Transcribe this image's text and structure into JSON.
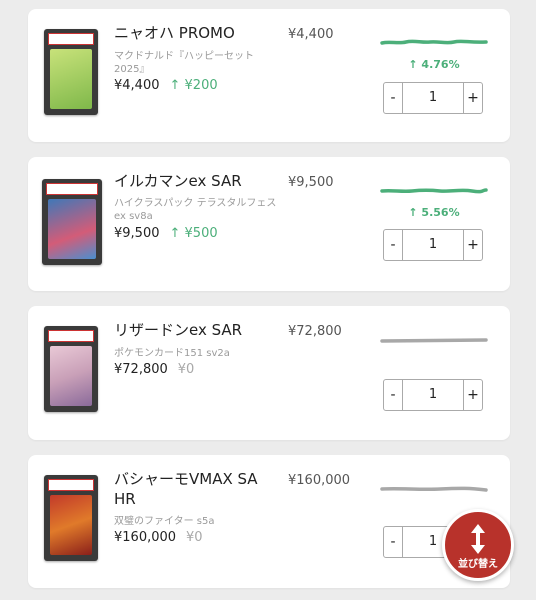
{
  "items": [
    {
      "name": "ニャオハ PROMO",
      "subtitle": "マクドナルド『ハッピーセット 2025』",
      "price": "¥4,400",
      "delta": "↑ ¥200",
      "market_price": "¥4,400",
      "percent": "↑ 4.76%",
      "trend": "up",
      "quantity": "1",
      "minus_label": "-",
      "plus_label": "+"
    },
    {
      "name": "イルカマンex SAR",
      "subtitle": "ハイクラスパック テラスタルフェスex sv8a",
      "price": "¥9,500",
      "delta": "↑ ¥500",
      "market_price": "¥9,500",
      "percent": "↑ 5.56%",
      "trend": "up",
      "quantity": "1",
      "minus_label": "-",
      "plus_label": "+"
    },
    {
      "name": "リザードンex SAR",
      "subtitle": "ポケモンカード151 sv2a",
      "price": "¥72,800",
      "delta": "¥0",
      "market_price": "¥72,800",
      "percent": "",
      "trend": "flat",
      "quantity": "1",
      "minus_label": "-",
      "plus_label": "+"
    },
    {
      "name": "バシャーモVMAX SA HR",
      "subtitle": "双璧のファイター s5a",
      "price": "¥160,000",
      "delta": "¥0",
      "market_price": "¥160,000",
      "percent": "",
      "trend": "flat",
      "quantity": "1",
      "minus_label": "-",
      "plus_label": "+"
    }
  ],
  "sort_button": {
    "label": "並び替え",
    "icon": "sort-arrows-icon"
  },
  "colors": {
    "up": "#4caf7a",
    "flat": "#a8a8a8",
    "accent": "#b8322b"
  }
}
